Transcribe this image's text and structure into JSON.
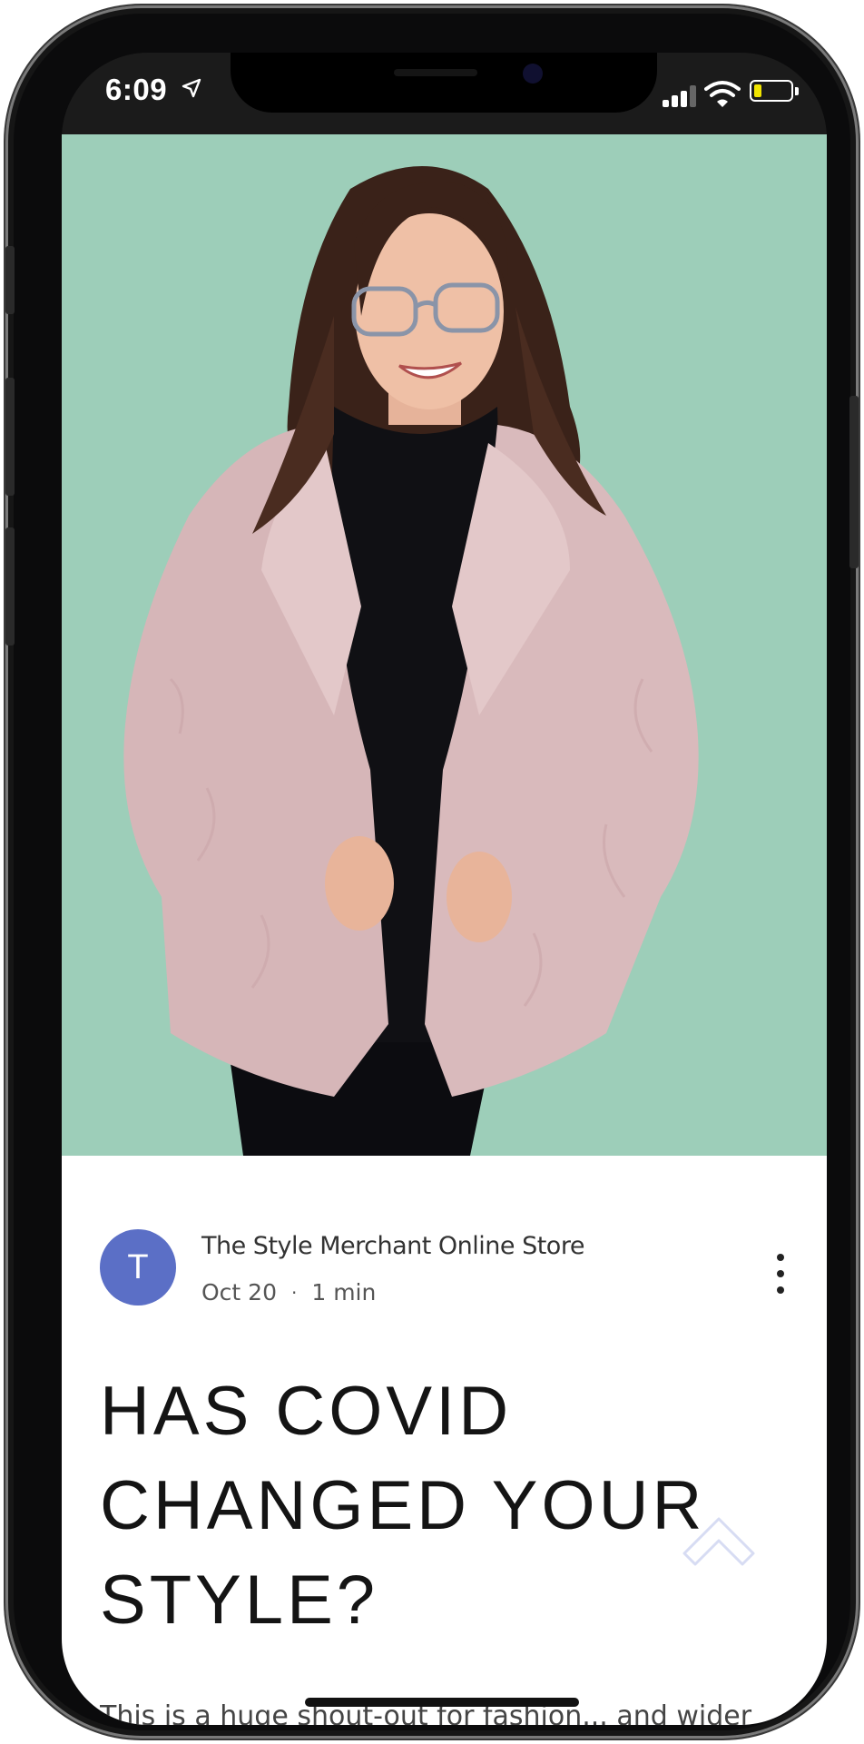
{
  "status_bar": {
    "time": "6:09",
    "icons": [
      "location-arrow-icon",
      "cellular-signal-icon",
      "wifi-icon",
      "battery-icon"
    ],
    "battery_level": 0.2,
    "colors": {
      "battery_fill": "#f0e400",
      "text": "#ffffff"
    }
  },
  "hero": {
    "image_description_icon": "photo",
    "background_color": "#9dceb9"
  },
  "post": {
    "avatar_initial": "T",
    "avatar_color": "#5b6fc6",
    "author": "The Style Merchant Online Store",
    "date": "Oct 20",
    "separator": "·",
    "read_time": "1 min",
    "more_icon": "more-vertical-icon",
    "title_lines": [
      "HAS COVID",
      "CHANGED YOUR",
      "STYLE?"
    ],
    "excerpt": "This is a huge shout-out for fashion... and wider"
  }
}
